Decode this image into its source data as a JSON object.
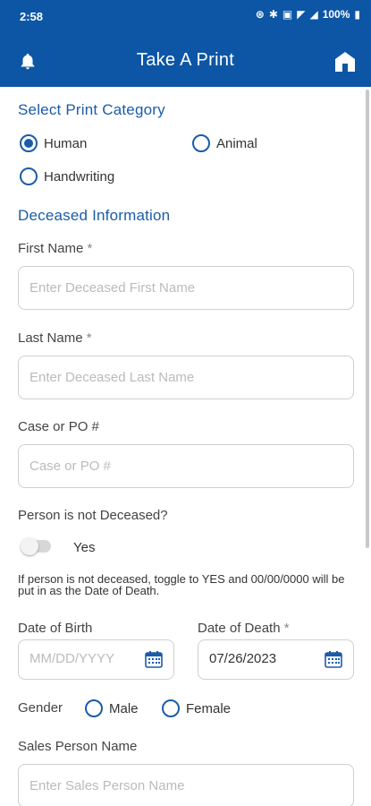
{
  "status": {
    "time": "2:58",
    "battery": "100%"
  },
  "header": {
    "title": "Take A Print"
  },
  "category": {
    "heading": "Select Print Category",
    "options": [
      {
        "label": "Human",
        "selected": true
      },
      {
        "label": "Animal",
        "selected": false
      },
      {
        "label": "Handwriting",
        "selected": false
      }
    ]
  },
  "deceased": {
    "heading": "Deceased Information",
    "first_name": {
      "label": "First Name",
      "required": "*",
      "placeholder": "Enter Deceased First Name",
      "value": ""
    },
    "last_name": {
      "label": "Last Name",
      "required": "*",
      "placeholder": "Enter Deceased Last Name",
      "value": ""
    },
    "case_po": {
      "label": "Case or PO #",
      "placeholder": "Case or PO #",
      "value": ""
    },
    "not_deceased": {
      "label": "Person is not Deceased?",
      "toggle_label": "Yes",
      "toggle_on": false,
      "note": "If person is not deceased, toggle to YES and 00/00/0000 will be put in as the Date of Death."
    },
    "dob": {
      "label": "Date of Birth",
      "placeholder": "MM/DD/YYYY",
      "value": ""
    },
    "dod": {
      "label": "Date of Death",
      "required": "*",
      "value": "07/26/2023"
    },
    "gender": {
      "label": "Gender",
      "options": [
        {
          "label": "Male",
          "selected": false
        },
        {
          "label": "Female",
          "selected": false
        }
      ]
    },
    "sales": {
      "label": "Sales Person Name",
      "placeholder": "Enter Sales Person Name",
      "value": ""
    }
  },
  "colors": {
    "primary": "#0d56a6",
    "accent": "#1b5ca8"
  },
  "icons": {
    "bell": "bell-icon",
    "home": "home-icon",
    "calendar": "calendar-icon"
  }
}
